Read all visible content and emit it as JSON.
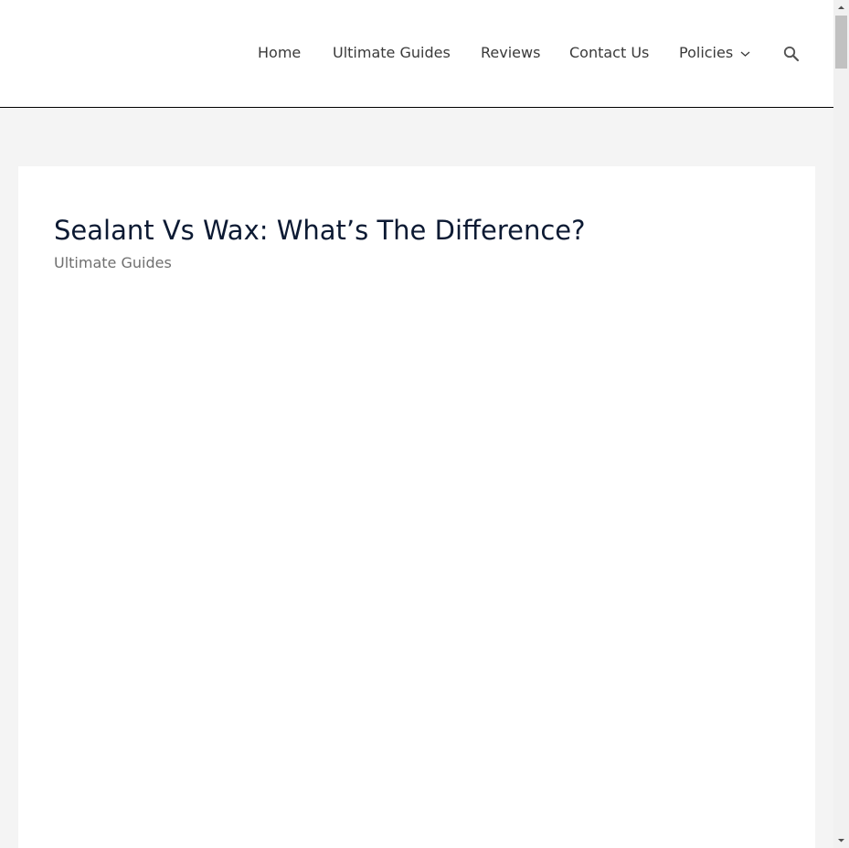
{
  "header": {
    "nav": {
      "home": "Home",
      "ultimate_guides": "Ultimate Guides",
      "reviews": "Reviews",
      "contact_us": "Contact Us",
      "policies": "Policies"
    },
    "icons": {
      "policies_dropdown": "chevron-down-icon",
      "search": "search-icon"
    }
  },
  "article": {
    "title": "Sealant Vs Wax: What’s The Difference?",
    "category": "Ultimate Guides"
  },
  "colors": {
    "page_background": "#f4f4f4",
    "nav_text": "#3a3a3a",
    "title_text": "#0c1a33",
    "category_text": "#6f6f6f"
  }
}
